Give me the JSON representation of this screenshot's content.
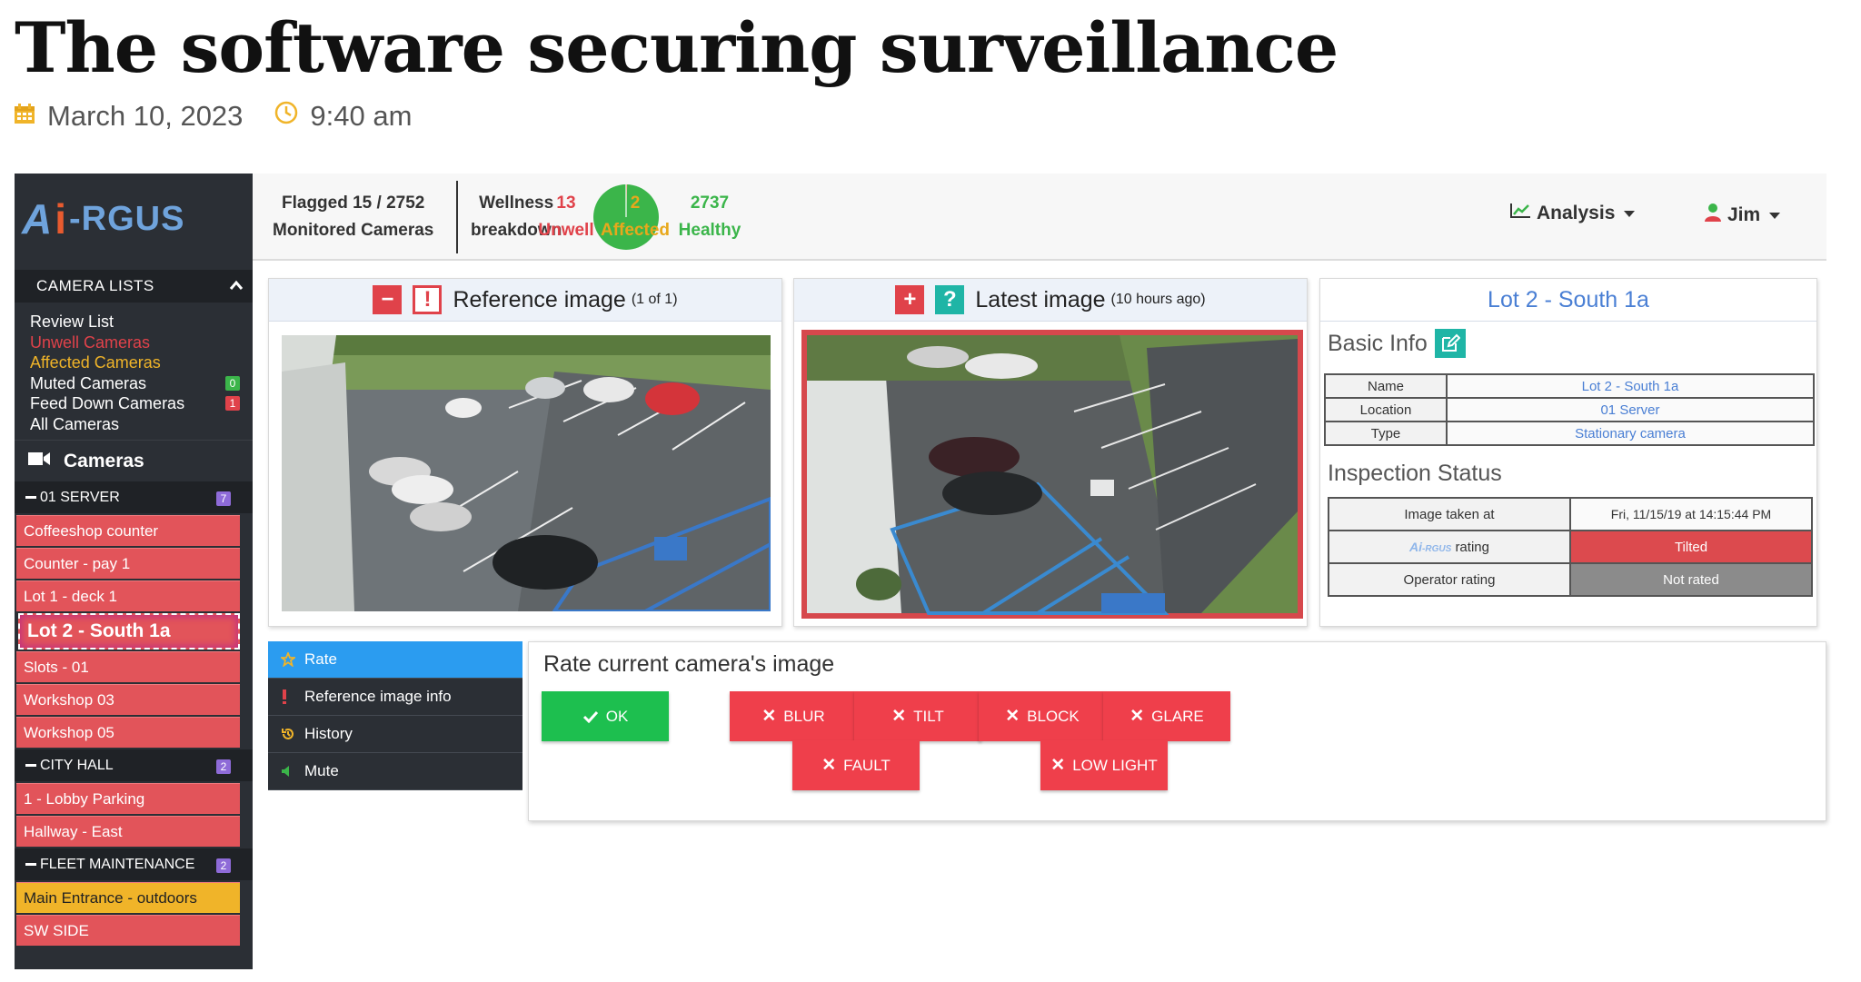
{
  "article": {
    "title": "The software securing surveillance",
    "date": "March 10, 2023",
    "time": "9:40 am"
  },
  "app": {
    "logo_a": "A",
    "logo_i": "i",
    "logo_rest": "-RGUS",
    "sidebar": {
      "camera_lists_label": "CAMERA LISTS",
      "lists": [
        {
          "label": "Review List",
          "color": "#ffffff"
        },
        {
          "label": "Unwell Cameras",
          "color": "#e0424a"
        },
        {
          "label": "Affected Cameras",
          "color": "#f0b429"
        },
        {
          "label": "Muted Cameras",
          "color": "#ffffff",
          "count": "0",
          "count_color": "green"
        },
        {
          "label": "Feed Down Cameras",
          "color": "#ffffff",
          "count": "1",
          "count_color": "red"
        },
        {
          "label": "All Cameras",
          "color": "#ffffff"
        }
      ],
      "cameras_label": "Cameras",
      "groups": [
        {
          "label": "01 SERVER",
          "count": "7",
          "cameras": [
            "Coffeeshop counter",
            "Counter - pay 1",
            "Lot 1 - deck 1",
            "Lot 2 - South 1a",
            "Slots - 01",
            "Workshop 03",
            "Workshop 05"
          ]
        },
        {
          "label": "CITY HALL",
          "count": "2",
          "cameras": [
            "1 - Lobby Parking",
            "Hallway - East"
          ]
        },
        {
          "label": "FLEET MAINTENANCE",
          "count": "2",
          "cameras": [
            "Main Entrance - outdoors",
            "SW SIDE"
          ]
        }
      ]
    },
    "topbar": {
      "flagged_line1": "Flagged 15 / 2752",
      "flagged_line2": "Monitored Cameras",
      "wellness_line1": "Wellness",
      "wellness_line2": "breakdown",
      "stats": [
        {
          "value": "13",
          "label": "Unwell",
          "color": "#e0424a"
        },
        {
          "value": "2",
          "label": "Affected",
          "color": "#e8a81c"
        },
        {
          "value": "2737",
          "label": "Healthy",
          "color": "#3bb54a"
        }
      ],
      "pie": {
        "unwell": 13,
        "affected": 2,
        "healthy": 2737
      },
      "analysis_label": "Analysis",
      "user_label": "Jim"
    },
    "reference": {
      "title": "Reference image",
      "subtitle": "(1 of 1)"
    },
    "latest": {
      "title": "Latest image",
      "subtitle": "(10 hours ago)"
    },
    "info": {
      "title": "Lot 2 - South 1a",
      "basic_info_label": "Basic Info",
      "basic": [
        {
          "key": "Name",
          "value": "Lot 2 - South 1a"
        },
        {
          "key": "Location",
          "value": "01 Server"
        },
        {
          "key": "Type",
          "value": "Stationary camera"
        }
      ],
      "inspection_label": "Inspection Status",
      "image_taken_key": "Image taken at",
      "image_taken_value": "Fri, 11/15/19 at 14:15:44 PM",
      "ai_rating_key": "rating",
      "ai_rating_value": "Tilted",
      "operator_key": "Operator rating",
      "operator_value": "Not rated"
    },
    "menu": [
      "Rate",
      "Reference image info",
      "History",
      "Mute"
    ],
    "rate": {
      "title": "Rate current camera's image",
      "ok": "OK",
      "buttons": [
        "BLUR",
        "TILT",
        "BLOCK",
        "GLARE",
        "FAULT",
        "LOW LIGHT"
      ]
    }
  }
}
